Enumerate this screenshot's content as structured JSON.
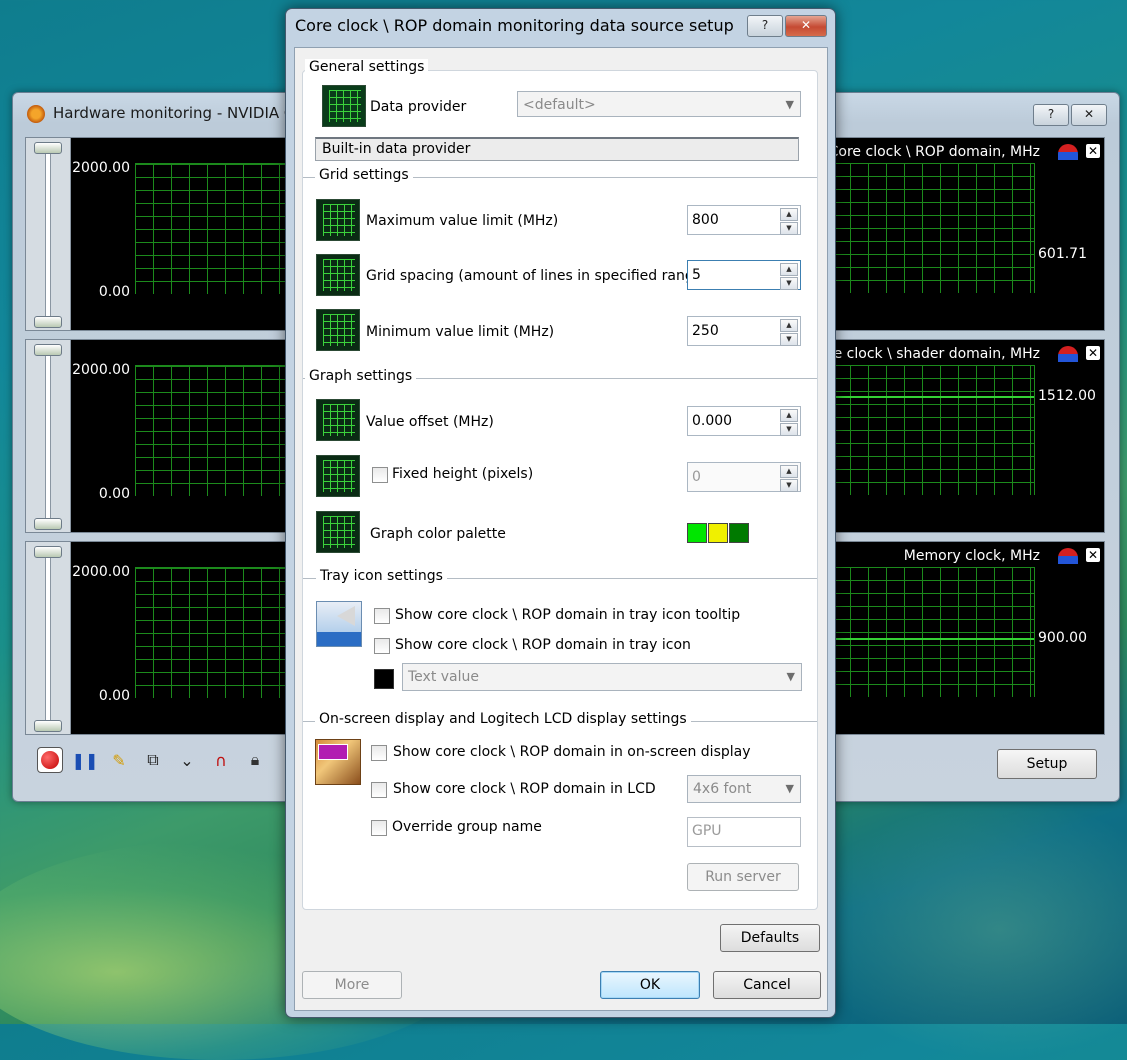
{
  "background_window": {
    "title": "Hardware monitoring - NVIDIA G",
    "caption_help": "?",
    "caption_close": "✕",
    "setup_label": "Setup",
    "panels": [
      {
        "y_max": "2000.00",
        "y_min": "0.00",
        "title": "Core clock \\ ROP domain, MHz",
        "current_value": "601.71"
      },
      {
        "y_max": "2000.00",
        "y_min": "0.00",
        "title": "re clock \\ shader domain, MHz",
        "current_value": "1512.00"
      },
      {
        "y_max": "2000.00",
        "y_min": "0.00",
        "title": "Memory clock, MHz",
        "current_value": "900.00"
      }
    ],
    "toolbar_icons": [
      "record-icon",
      "pause-icon",
      "brush-icon",
      "window-icon",
      "chevrons-icon",
      "magnet-icon",
      "lock-icon"
    ]
  },
  "dialog": {
    "title": "Core clock \\ ROP domain monitoring data source setup",
    "caption_help": "?",
    "caption_close": "✕",
    "general": {
      "header": "General settings",
      "data_provider_label": "Data provider",
      "data_provider_value": "<default>",
      "provider_description": "Built-in data provider"
    },
    "grid": {
      "header": "Grid settings",
      "max_label": "Maximum value limit (MHz)",
      "max_value": "800",
      "spacing_label": "Grid spacing (amount of lines in specified range)",
      "spacing_value": "5",
      "min_label": "Minimum value limit (MHz)",
      "min_value": "250"
    },
    "graph": {
      "header": "Graph settings",
      "offset_label": "Value offset (MHz)",
      "offset_value": "0.000",
      "fixed_height_label": "Fixed height (pixels)",
      "fixed_height_value": "0",
      "palette_label": "Graph color palette",
      "palette_colors": [
        "#00e600",
        "#f0f000",
        "#007a00"
      ]
    },
    "tray": {
      "header": "Tray icon settings",
      "tooltip_label": "Show core clock \\ ROP domain in tray icon tooltip",
      "icon_label": "Show core clock \\ ROP domain in tray icon",
      "mode_value": "Text value",
      "swatch_color": "#000000"
    },
    "osd": {
      "header": "On-screen display and Logitech LCD display settings",
      "osd_label": "Show core clock \\ ROP domain in on-screen display",
      "lcd_label": "Show core clock \\ ROP domain in LCD",
      "lcd_font_value": "4x6 font",
      "override_label": "Override group name",
      "group_name_value": "GPU",
      "run_server_label": "Run server"
    },
    "buttons": {
      "defaults": "Defaults",
      "more": "More",
      "ok": "OK",
      "cancel": "Cancel"
    }
  }
}
